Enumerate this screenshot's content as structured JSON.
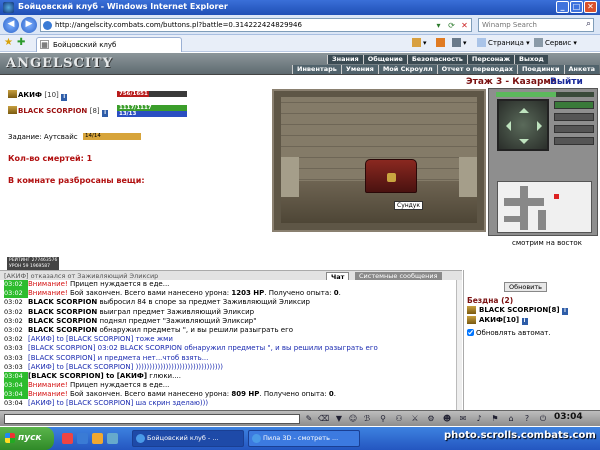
{
  "window": {
    "title": "Бойцовский клуб - Windows Internet Explorer"
  },
  "address": {
    "url": "http://angelscity.combats.com/buttons.pl?battle=0.314222424829946",
    "search_placeholder": "Winamp Search"
  },
  "tabbar": {
    "tab_label": "Бойцовский клуб",
    "commands": {
      "page": "Страница",
      "service": "Сервис"
    }
  },
  "game_header": {
    "logo": "ANGELSCITY",
    "menu_top": [
      "Знания",
      "Общение",
      "Безопасность",
      "Персонаж",
      "Выход"
    ],
    "menu_bottom": [
      "Инвентарь",
      "Умения",
      "Мой Скроулл",
      "Отчет о переводах",
      "Поединки",
      "Анкета"
    ]
  },
  "players": [
    {
      "name": "АКИФ",
      "level": "[10]",
      "hp_text": "756/1651",
      "hp_fraction": 0.46
    },
    {
      "name": "BLACK SCORPION",
      "level": "[8]",
      "hp_text": "1117/1117",
      "mana_text": "13/13",
      "hp_fraction": 1.0
    }
  ],
  "task": {
    "label": "Задание: Аутсвайс",
    "progress": "14/14"
  },
  "info": {
    "deaths": "Кол-во смертей: 1",
    "items_scattered": "В комнате разбросаны вещи:"
  },
  "location": {
    "name": "Этаж 3 - Казарма",
    "exit": "Выйти"
  },
  "scene": {
    "chest_label": "Сундук"
  },
  "minimap_caption": "смотрим на восток",
  "resist": {
    "line1": "РЕЙТИНГ 277463576",
    "line2": "УРОН 59 1969587"
  },
  "chat": {
    "tabs": {
      "chat": "Чат",
      "system": "Системные сообщения"
    },
    "partial_top": "[АКИФ] отказался от Заживляющий Эликсир",
    "lines": [
      {
        "time": "03:02",
        "green": true,
        "parts": [
          {
            "text": "Внимание!",
            "cls": "c-red"
          },
          {
            "text": " Прицеп нуждается в еде...",
            "cls": ""
          }
        ]
      },
      {
        "time": "03:02",
        "green": true,
        "parts": [
          {
            "text": "Внимание!",
            "cls": "c-red"
          },
          {
            "text": " Бой закончен. Всего вами нанесено урона: ",
            "cls": ""
          },
          {
            "text": "1203 HP",
            "cls": "c-bold"
          },
          {
            "text": ". Получено опыта: ",
            "cls": ""
          },
          {
            "text": "0",
            "cls": "c-bold"
          },
          {
            "text": ".",
            "cls": ""
          }
        ]
      },
      {
        "time": "03:02",
        "green": false,
        "parts": [
          {
            "text": "BLACK SCORPION",
            "cls": "c-bold"
          },
          {
            "text": " выбросил 84 в споре за предмет Заживляющий Эликсир",
            "cls": ""
          }
        ]
      },
      {
        "time": "03:02",
        "green": false,
        "parts": [
          {
            "text": "BLACK SCORPION",
            "cls": "c-bold"
          },
          {
            "text": " выиграл предмет Заживляющий Эликсир",
            "cls": ""
          }
        ]
      },
      {
        "time": "03:02",
        "green": false,
        "parts": [
          {
            "text": "BLACK SCORPION",
            "cls": "c-bold"
          },
          {
            "text": " поднял предмет \"Заживляющий Эликсир\"",
            "cls": ""
          }
        ]
      },
      {
        "time": "03:02",
        "green": false,
        "parts": [
          {
            "text": "BLACK SCORPION",
            "cls": "c-bold"
          },
          {
            "text": " обнаружил предметы \", и вы решили разыграть его",
            "cls": ""
          }
        ]
      },
      {
        "time": "03:02",
        "green": false,
        "parts": [
          {
            "text": "[АКИФ] to [BLACK SCORPION] тоже жми",
            "cls": "c-blue"
          }
        ]
      },
      {
        "time": "03:03",
        "green": false,
        "parts": [
          {
            "text": "[BLACK SCORPION] 03:02 BLACK SCORPION обнаружил предметы \", и вы решили разыграть его",
            "cls": "c-blue"
          }
        ]
      },
      {
        "time": "03:03",
        "green": false,
        "parts": [
          {
            "text": "[BLACK SCORPION] и предмета нет...чтоб взять...",
            "cls": "c-blue"
          }
        ]
      },
      {
        "time": "03:03",
        "green": false,
        "parts": [
          {
            "text": "[АКИФ] to [BLACK SCORPION] ))))))))))))))))))))))))))))))))",
            "cls": "c-blue"
          }
        ]
      },
      {
        "time": "03:04",
        "green": true,
        "parts": [
          {
            "text": "[BLACK SCORPION] to [АКИФ]",
            "cls": "c-bold"
          },
          {
            "text": " глюки....",
            "cls": ""
          }
        ]
      },
      {
        "time": "03:04",
        "green": true,
        "parts": [
          {
            "text": "Внимание!",
            "cls": "c-red"
          },
          {
            "text": " Прицеп нуждается в еде...",
            "cls": ""
          }
        ]
      },
      {
        "time": "03:04",
        "green": true,
        "parts": [
          {
            "text": "Внимание!",
            "cls": "c-red"
          },
          {
            "text": " Бой закончен. Всего вами нанесено урона: ",
            "cls": ""
          },
          {
            "text": "809 HP",
            "cls": "c-bold"
          },
          {
            "text": ". Получено опыта: ",
            "cls": ""
          },
          {
            "text": "0",
            "cls": "c-bold"
          },
          {
            "text": ".",
            "cls": ""
          }
        ]
      },
      {
        "time": "03:04",
        "green": false,
        "parts": [
          {
            "text": "[АКИФ] to [BLACK SCORPION] ша скрин зделаю)))",
            "cls": "c-blue"
          }
        ]
      }
    ]
  },
  "roster": {
    "refresh": "Обновить",
    "title": "Бездна (2)",
    "members": [
      {
        "name": "BLACK SCORPION",
        "level": "[8]"
      },
      {
        "name": "АКИФ",
        "level": "[10]"
      }
    ],
    "auto_refresh": "Обновлять автомат."
  },
  "toolbar": {
    "clock": "03:04"
  },
  "taskbar": {
    "start": "пуск",
    "tasks": [
      "Бойцовский клуб - ...",
      "Пила 3D - смотреть ..."
    ]
  },
  "watermark": "photo.scrolls.combats.com",
  "colors": {
    "hp_green": "#3b9e2b",
    "hp_red": "#b81c1c",
    "mana_blue": "#2b4ec2",
    "enemy_name": "#9b1010"
  }
}
